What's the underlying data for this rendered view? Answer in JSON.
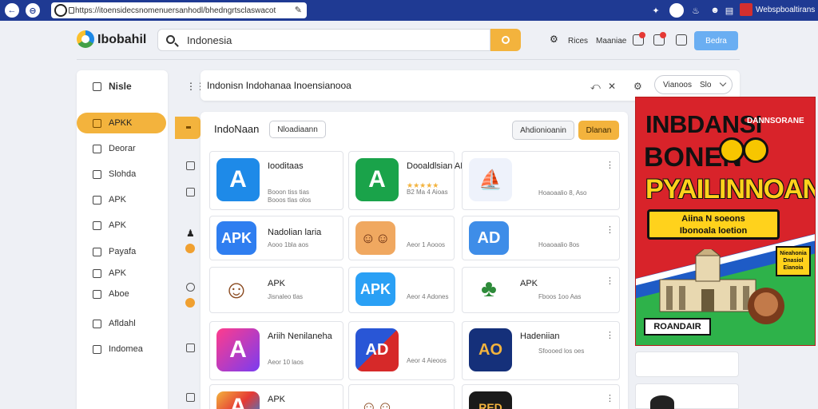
{
  "browser": {
    "url": "https://itoensidecsnomenuersanhodl/bhedngrtsclaswacot",
    "profile_name": "Webspboaltirans"
  },
  "header": {
    "brand": "Ibobahil",
    "search_value": "Indonesia",
    "links": [
      "Rices",
      "Maaniae"
    ],
    "login_label": "Bedra"
  },
  "sidebar": {
    "header": "Nisle",
    "items": [
      {
        "label": "APKK",
        "active": true
      },
      {
        "label": "Deorar"
      },
      {
        "label": "Slohda"
      },
      {
        "label": "APK"
      },
      {
        "label": "APK"
      },
      {
        "label": "Payafa"
      },
      {
        "label": "APK"
      },
      {
        "label": "Aboe"
      },
      {
        "label": "Afldahl"
      },
      {
        "label": "Indomea"
      }
    ]
  },
  "breadcrumb": {
    "text": "Indonisn Indohanaa Inoensianooa",
    "sort_label": "Vianoos",
    "sort_value": "Slo"
  },
  "panel": {
    "title": "IndoNaan",
    "chip": "Nloadiaann",
    "filter_button": "Ahdionioanin",
    "action_button": "Dlanan"
  },
  "apps": [
    {
      "name": "Iooditaas",
      "meta": "Booon tiss tias\nBooos tlas olos",
      "icon": "a-blue",
      "rating": ""
    },
    {
      "name": "Dooaldlsian APK",
      "meta": "B2 Ma 4 Aioas",
      "icon": "a-green",
      "rating": "★★★★★"
    },
    {
      "name": "",
      "meta": "Hoaoaalio 8, Aso",
      "icon": "hat",
      "rating": ""
    },
    {
      "name": "Nadolian laria",
      "meta": "Aooo 1bla aos",
      "icon": "apk-blue",
      "rating": ""
    },
    {
      "name": "",
      "meta": "Aeor 1 Aooos",
      "icon": "figures",
      "rating": ""
    },
    {
      "name": "",
      "meta": "Hoaoaalio 8os",
      "icon": "ad-blue",
      "rating": ""
    },
    {
      "name": "APK",
      "meta": "Jisnaleo tlas",
      "icon": "avatar",
      "rating": ""
    },
    {
      "name": "",
      "meta": "Aeor 4 Adones",
      "icon": "apk-blue2",
      "rating": ""
    },
    {
      "name": "APK",
      "meta": "Fboos 1oo Aas",
      "icon": "parrot",
      "rating": ""
    },
    {
      "name": "Ariih Nenilaneha",
      "meta": "Aeor 10 laos",
      "icon": "a-gradient",
      "rating": ""
    },
    {
      "name": "",
      "meta": "Aeor 4 Aieoos",
      "icon": "ad-red",
      "rating": ""
    },
    {
      "name": "Hadeniian",
      "meta": "Sfoooed los oes",
      "icon": "ao-navy",
      "rating": ""
    },
    {
      "name": "APK",
      "meta": "",
      "icon": "a-multi",
      "rating": ""
    },
    {
      "name": "",
      "meta": "",
      "icon": "figures2",
      "rating": ""
    },
    {
      "name": "",
      "meta": "",
      "icon": "red-black",
      "rating": ""
    }
  ],
  "ad": {
    "title": "INBDANSI",
    "subtitle": "DANNSORANE",
    "line2": "BONEN",
    "line3": "PYAILINNOAN",
    "box_text": "Aiina N soeons\nIbonoala loetion",
    "small_box": "Nieahonia Dnasiol Eianoia",
    "footer": "ROANDAIR"
  },
  "colors": {
    "accent": "#f3b33d",
    "browser_bar": "#1f3a93",
    "login": "#6aaef2",
    "ad_red": "#d8232a"
  }
}
